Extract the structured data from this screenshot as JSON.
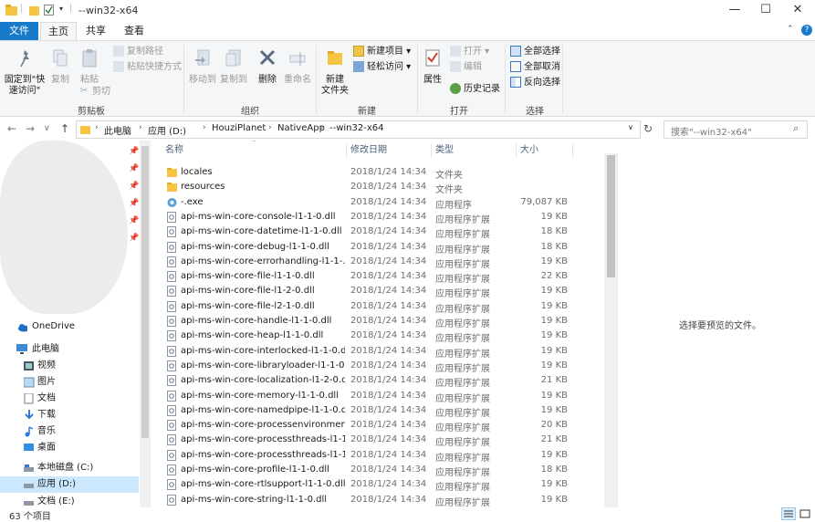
{
  "window": {
    "title": "--win32-x64",
    "controls": {
      "minimize": "—",
      "maximize": "☐",
      "close": "✕"
    }
  },
  "ribbon_tabs": [
    "文件",
    "主页",
    "共享",
    "查看"
  ],
  "ribbon": {
    "clipboard": {
      "pin_quick_access": "固定到\"快\n速访问\"",
      "copy": "复制",
      "paste": "粘贴",
      "copy_path": "复制路径",
      "paste_shortcut": "粘贴快捷方式",
      "cut": "剪切",
      "label": "剪贴板"
    },
    "organize": {
      "move_to": "移动到",
      "copy_to": "复制到",
      "delete": "删除",
      "rename": "重命名",
      "label": "组织"
    },
    "new": {
      "new_folder": "新建\n文件夹",
      "new_item": "新建项目",
      "easy_access": "轻松访问",
      "label": "新建"
    },
    "open": {
      "properties": "属性",
      "open": "打开",
      "edit": "编辑",
      "history": "历史记录",
      "label": "打开"
    },
    "select": {
      "select_all": "全部选择",
      "select_none": "全部取消",
      "invert": "反向选择",
      "label": "选择"
    }
  },
  "address": {
    "crumbs": [
      "此电脑",
      "应用 (D:)",
      "HouziPlanet",
      "NativeApp",
      "--win32-x64"
    ],
    "search_placeholder": "搜索\"--win32-x64\""
  },
  "nav_pane": {
    "items": [
      {
        "label": "OneDrive",
        "icon": "cloud-icon"
      },
      {
        "label": "此电脑",
        "icon": "computer-icon"
      },
      {
        "label": "视频",
        "icon": "video-folder-icon"
      },
      {
        "label": "图片",
        "icon": "pictures-folder-icon"
      },
      {
        "label": "文档",
        "icon": "documents-folder-icon"
      },
      {
        "label": "下载",
        "icon": "download-folder-icon"
      },
      {
        "label": "音乐",
        "icon": "music-folder-icon"
      },
      {
        "label": "桌面",
        "icon": "desktop-folder-icon"
      },
      {
        "label": "本地磁盘 (C:)",
        "icon": "drive-icon"
      },
      {
        "label": "应用 (D:)",
        "icon": "drive-icon"
      },
      {
        "label": "文档 (E:)",
        "icon": "drive-icon"
      }
    ],
    "selected": "应用 (D:)"
  },
  "columns": {
    "name": "名称",
    "date": "修改日期",
    "type": "类型",
    "size": "大小"
  },
  "files": [
    {
      "name": "locales",
      "date": "2018/1/24 14:34",
      "type": "文件夹",
      "size": "",
      "kind": "folder"
    },
    {
      "name": "resources",
      "date": "2018/1/24 14:34",
      "type": "文件夹",
      "size": "",
      "kind": "folder"
    },
    {
      "name": "-.exe",
      "date": "2018/1/24 14:34",
      "type": "应用程序",
      "size": "79,087 KB",
      "kind": "exe"
    },
    {
      "name": "api-ms-win-core-console-l1-1-0.dll",
      "date": "2018/1/24 14:34",
      "type": "应用程序扩展",
      "size": "19 KB",
      "kind": "dll"
    },
    {
      "name": "api-ms-win-core-datetime-l1-1-0.dll",
      "date": "2018/1/24 14:34",
      "type": "应用程序扩展",
      "size": "18 KB",
      "kind": "dll"
    },
    {
      "name": "api-ms-win-core-debug-l1-1-0.dll",
      "date": "2018/1/24 14:34",
      "type": "应用程序扩展",
      "size": "18 KB",
      "kind": "dll"
    },
    {
      "name": "api-ms-win-core-errorhandling-l1-1-...",
      "date": "2018/1/24 14:34",
      "type": "应用程序扩展",
      "size": "19 KB",
      "kind": "dll"
    },
    {
      "name": "api-ms-win-core-file-l1-1-0.dll",
      "date": "2018/1/24 14:34",
      "type": "应用程序扩展",
      "size": "22 KB",
      "kind": "dll"
    },
    {
      "name": "api-ms-win-core-file-l1-2-0.dll",
      "date": "2018/1/24 14:34",
      "type": "应用程序扩展",
      "size": "19 KB",
      "kind": "dll"
    },
    {
      "name": "api-ms-win-core-file-l2-1-0.dll",
      "date": "2018/1/24 14:34",
      "type": "应用程序扩展",
      "size": "19 KB",
      "kind": "dll"
    },
    {
      "name": "api-ms-win-core-handle-l1-1-0.dll",
      "date": "2018/1/24 14:34",
      "type": "应用程序扩展",
      "size": "19 KB",
      "kind": "dll"
    },
    {
      "name": "api-ms-win-core-heap-l1-1-0.dll",
      "date": "2018/1/24 14:34",
      "type": "应用程序扩展",
      "size": "19 KB",
      "kind": "dll"
    },
    {
      "name": "api-ms-win-core-interlocked-l1-1-0.dll",
      "date": "2018/1/24 14:34",
      "type": "应用程序扩展",
      "size": "19 KB",
      "kind": "dll"
    },
    {
      "name": "api-ms-win-core-libraryloader-l1-1-0...",
      "date": "2018/1/24 14:34",
      "type": "应用程序扩展",
      "size": "19 KB",
      "kind": "dll"
    },
    {
      "name": "api-ms-win-core-localization-l1-2-0.dll",
      "date": "2018/1/24 14:34",
      "type": "应用程序扩展",
      "size": "21 KB",
      "kind": "dll"
    },
    {
      "name": "api-ms-win-core-memory-l1-1-0.dll",
      "date": "2018/1/24 14:34",
      "type": "应用程序扩展",
      "size": "19 KB",
      "kind": "dll"
    },
    {
      "name": "api-ms-win-core-namedpipe-l1-1-0.dll",
      "date": "2018/1/24 14:34",
      "type": "应用程序扩展",
      "size": "19 KB",
      "kind": "dll"
    },
    {
      "name": "api-ms-win-core-processenvironmen...",
      "date": "2018/1/24 14:34",
      "type": "应用程序扩展",
      "size": "20 KB",
      "kind": "dll"
    },
    {
      "name": "api-ms-win-core-processthreads-l1-1...",
      "date": "2018/1/24 14:34",
      "type": "应用程序扩展",
      "size": "21 KB",
      "kind": "dll"
    },
    {
      "name": "api-ms-win-core-processthreads-l1-1...",
      "date": "2018/1/24 14:34",
      "type": "应用程序扩展",
      "size": "19 KB",
      "kind": "dll"
    },
    {
      "name": "api-ms-win-core-profile-l1-1-0.dll",
      "date": "2018/1/24 14:34",
      "type": "应用程序扩展",
      "size": "18 KB",
      "kind": "dll"
    },
    {
      "name": "api-ms-win-core-rtlsupport-l1-1-0.dll",
      "date": "2018/1/24 14:34",
      "type": "应用程序扩展",
      "size": "19 KB",
      "kind": "dll"
    },
    {
      "name": "api-ms-win-core-string-l1-1-0.dll",
      "date": "2018/1/24 14:34",
      "type": "应用程序扩展",
      "size": "19 KB",
      "kind": "dll"
    }
  ],
  "preview_text": "选择要预览的文件。",
  "status": {
    "item_count": "63 个项目"
  },
  "colors": {
    "accent": "#1979ca",
    "selected_bg": "#cce8ff",
    "folder": "#f5c542"
  }
}
